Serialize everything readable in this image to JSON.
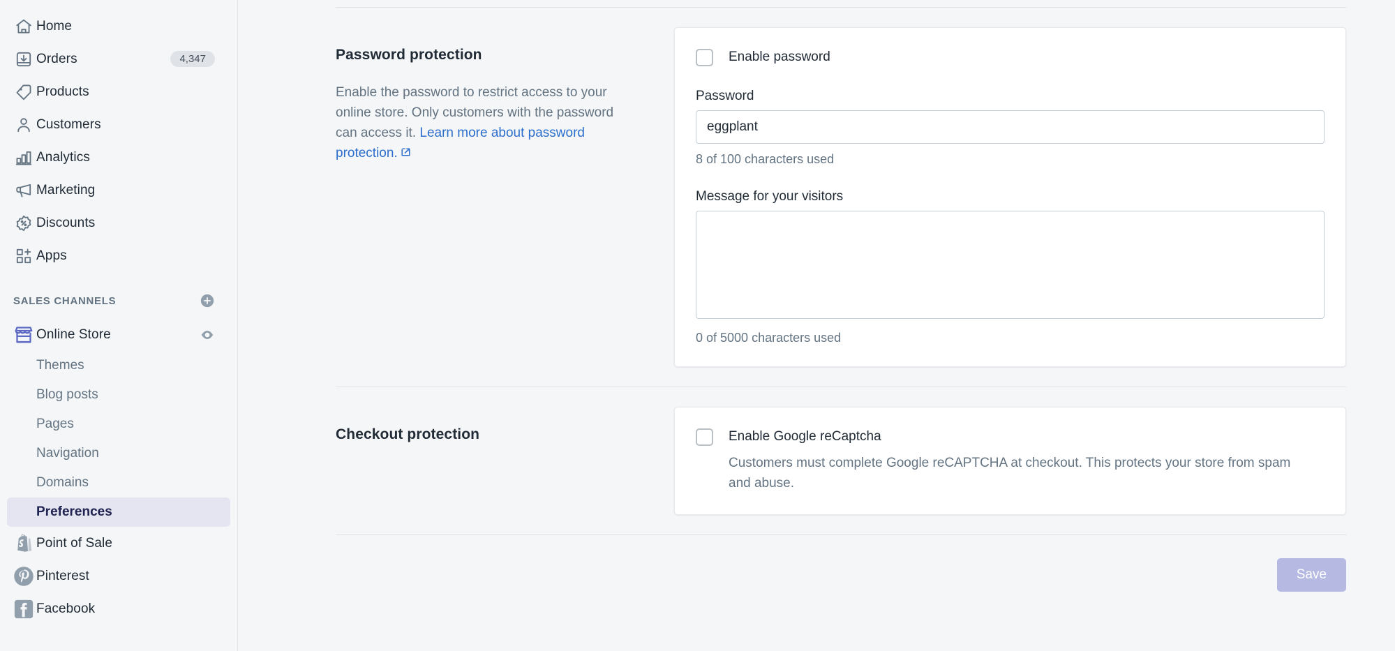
{
  "sidebar": {
    "items": [
      {
        "label": "Home",
        "icon": "home-icon",
        "badge": ""
      },
      {
        "label": "Orders",
        "icon": "orders-icon",
        "badge": "4,347"
      },
      {
        "label": "Products",
        "icon": "tag-icon",
        "badge": ""
      },
      {
        "label": "Customers",
        "icon": "person-icon",
        "badge": ""
      },
      {
        "label": "Analytics",
        "icon": "bar-chart-icon",
        "badge": ""
      },
      {
        "label": "Marketing",
        "icon": "megaphone-icon",
        "badge": ""
      },
      {
        "label": "Discounts",
        "icon": "discount-percent-icon",
        "badge": ""
      },
      {
        "label": "Apps",
        "icon": "apps-grid-plus-icon",
        "badge": ""
      }
    ],
    "section_title": "SALES CHANNELS",
    "add_channel_icon": "plus-circle-icon",
    "online_store": {
      "label": "Online Store",
      "icon": "storefront-icon",
      "view_icon": "eye-icon"
    },
    "sub_items": [
      {
        "label": "Themes",
        "active": false
      },
      {
        "label": "Blog posts",
        "active": false
      },
      {
        "label": "Pages",
        "active": false
      },
      {
        "label": "Navigation",
        "active": false
      },
      {
        "label": "Domains",
        "active": false
      },
      {
        "label": "Preferences",
        "active": true
      }
    ],
    "channels": [
      {
        "label": "Point of Sale",
        "icon": "shopify-bag-icon"
      },
      {
        "label": "Pinterest",
        "icon": "pinterest-icon"
      },
      {
        "label": "Facebook",
        "icon": "facebook-icon"
      }
    ]
  },
  "password_section": {
    "title": "Password protection",
    "description_lead": "Enable the password to restrict access to your online store. Only customers with the password can access it. ",
    "link_text": "Learn more about password protection.",
    "link_icon": "external-link-icon",
    "enable_checkbox_label": "Enable password",
    "enable_checked": false,
    "password_label": "Password",
    "password_value": "eggplant",
    "password_help": "8 of 100 characters used",
    "message_label": "Message for your visitors",
    "message_value": "",
    "message_help": "0 of 5000 characters used"
  },
  "checkout_section": {
    "title": "Checkout protection",
    "recaptcha_checkbox_label": "Enable Google reCaptcha",
    "recaptcha_checked": false,
    "recaptcha_help": "Customers must complete Google reCAPTCHA at checkout. This protects your store from spam and abuse."
  },
  "footer": {
    "save_label": "Save",
    "save_disabled": true
  },
  "colors": {
    "page_bg": "#f4f6f8",
    "card_bg": "#ffffff",
    "border": "#dfe3e8",
    "text": "#212b36",
    "subdued_text": "#637381",
    "link": "#2c6ecb",
    "active_nav_bg": "#e4e5f0",
    "active_nav_text": "#202351",
    "save_disabled_bg": "#b6bae3",
    "badge_bg": "#dfe3e8"
  }
}
